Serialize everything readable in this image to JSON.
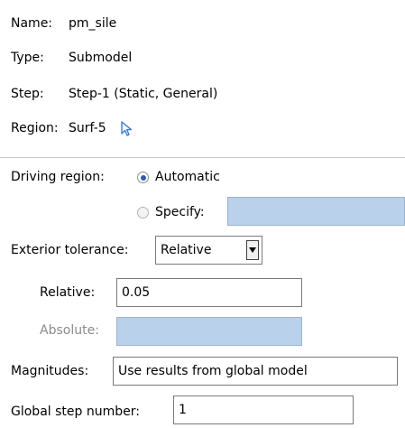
{
  "info": {
    "name_label": "Name:",
    "name_value": "pm_sile",
    "type_label": "Type:",
    "type_value": "Submodel",
    "step_label": "Step:",
    "step_value": "Step-1 (Static, General)",
    "region_label": "Region:",
    "region_value": "Surf-5",
    "region_icon": "cursor-arrow-icon"
  },
  "driving_region": {
    "label": "Driving region:",
    "options": [
      {
        "label": "Automatic",
        "selected": true
      },
      {
        "label": "Specify:",
        "selected": false
      }
    ],
    "specify_value": ""
  },
  "exterior_tolerance": {
    "label": "Exterior tolerance:",
    "selected": "Relative",
    "relative_label": "Relative:",
    "relative_value": "0.05",
    "absolute_label": "Absolute:",
    "absolute_value": ""
  },
  "magnitudes": {
    "label": "Magnitudes:",
    "value": "Use results from global model"
  },
  "global_step": {
    "label": "Global step number:",
    "value": "1"
  },
  "colors": {
    "disabled_field": "#b9d1ea",
    "radio_selected": "#2b5fa6",
    "cursor_icon": "#3a7bd5"
  }
}
